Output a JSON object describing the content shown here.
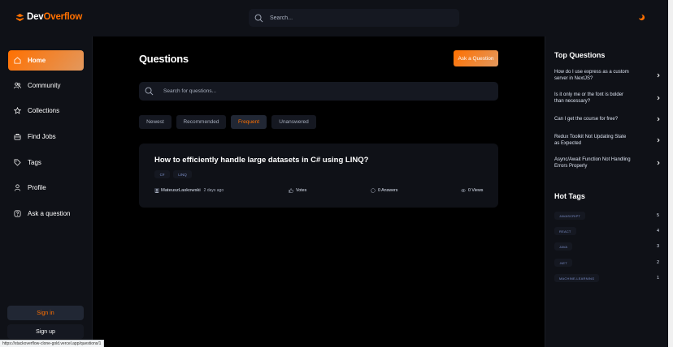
{
  "header": {
    "logo_prefix": "Dev",
    "logo_suffix": "Overflow",
    "search_placeholder": "Search..."
  },
  "sidebar": {
    "items": [
      {
        "label": "Home",
        "icon": "home-icon",
        "active": true
      },
      {
        "label": "Community",
        "icon": "users-icon",
        "active": false
      },
      {
        "label": "Collections",
        "icon": "star-icon",
        "active": false
      },
      {
        "label": "Find Jobs",
        "icon": "suitcase-icon",
        "active": false
      },
      {
        "label": "Tags",
        "icon": "tag-icon",
        "active": false
      },
      {
        "label": "Profile",
        "icon": "user-icon",
        "active": false
      },
      {
        "label": "Ask a question",
        "icon": "question-mark-icon",
        "active": false
      }
    ],
    "sign_in": "Sign in",
    "sign_up": "Sign up"
  },
  "main": {
    "title": "Questions",
    "ask_button": "Ask a Question",
    "search_placeholder": "Search for questions...",
    "filters": [
      {
        "label": "Newest",
        "active": false
      },
      {
        "label": "Recommended",
        "active": false
      },
      {
        "label": "Frequent",
        "active": true
      },
      {
        "label": "Unanswered",
        "active": false
      }
    ],
    "questions": [
      {
        "title": "How to efficiently handle large datasets in C# using LINQ?",
        "tags": [
          "C#",
          "LINQ"
        ],
        "author": "MateuszLaskowski",
        "time": "2 days ago",
        "votes": "Votes",
        "answers": "0 Answers",
        "views": "0 Views"
      }
    ]
  },
  "right_sidebar": {
    "top_questions_heading": "Top Questions",
    "top_questions": [
      "How do I use express as a custom server in NextJS?",
      "Is it only me or the font is bolder than necessary?",
      "Can I get the course for free?",
      "Redux Toolkit Not Updating State as Expected",
      "Async/Await Function Not Handling Errors Properly"
    ],
    "hot_tags_heading": "Hot Tags",
    "hot_tags": [
      {
        "name": "JAVASCRIPT",
        "count": "5"
      },
      {
        "name": "REACT",
        "count": "4"
      },
      {
        "name": "JAVA",
        "count": "3"
      },
      {
        "name": ".NET",
        "count": "2"
      },
      {
        "name": "MACHINE-LEARNING",
        "count": "1"
      }
    ]
  },
  "status_bar": {
    "url": "https://stackoverflow-clone-gold.vercel.app/questions/1"
  },
  "colors": {
    "accent": "#ff7000",
    "background": "#000000",
    "panel": "#0f1117",
    "input": "#151821",
    "tag_text": "#7b8ec8"
  }
}
